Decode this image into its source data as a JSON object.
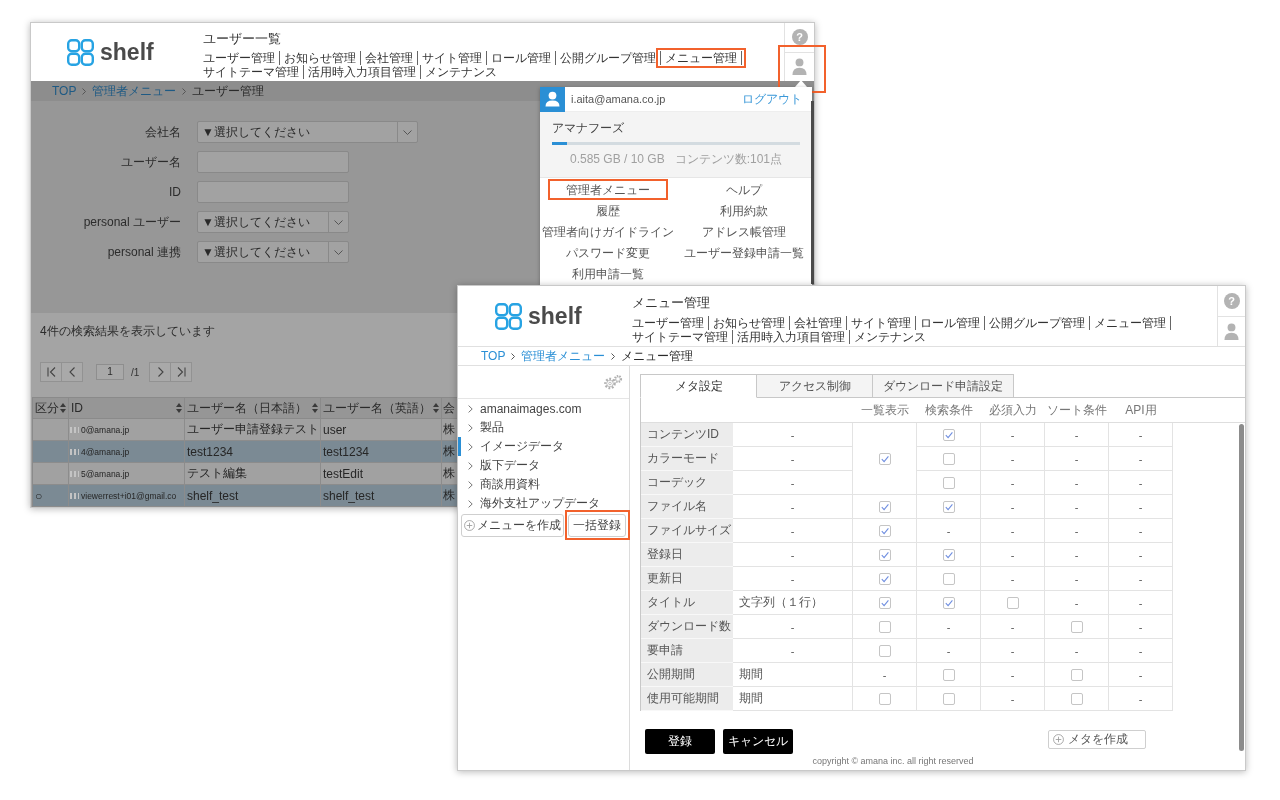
{
  "user_list_window": {
    "logo": "shelf",
    "title": "ユーザー一覧",
    "nav": [
      {
        "label": "ユーザー管理",
        "highlighted": false
      },
      {
        "label": "お知らせ管理",
        "highlighted": false
      },
      {
        "label": "会社管理",
        "highlighted": false
      },
      {
        "label": "サイト管理",
        "highlighted": false
      },
      {
        "label": "ロール管理",
        "highlighted": false
      },
      {
        "label": "公開グループ管理",
        "highlighted": false
      },
      {
        "label": "メニュー管理",
        "highlighted": true
      },
      {
        "label": "サイトテーマ管理",
        "highlighted": false
      },
      {
        "label": "活用時入力項目管理",
        "highlighted": false
      },
      {
        "label": "メンテナンス",
        "highlighted": false
      }
    ],
    "help": "?",
    "user_button": {
      "highlighted": true
    },
    "breadcrumb": [
      {
        "label": "TOP",
        "link": true
      },
      {
        "label": "管理者メニュー",
        "link": true
      },
      {
        "label": "ユーザー管理",
        "link": false
      }
    ],
    "search_form": [
      {
        "label": "会社名",
        "kind": "select",
        "value": "▼選択してください"
      },
      {
        "label": "ユーザー名",
        "kind": "text"
      },
      {
        "label": "ID",
        "kind": "text"
      },
      {
        "label": "personal ユーザー",
        "kind": "select",
        "value": "▼選択してください"
      },
      {
        "label": "personal 連携",
        "kind": "select",
        "value": "▼選択してください"
      }
    ],
    "result_count": "4件の検索結果を表示しています",
    "pager": {
      "page": "1",
      "total": "/1"
    },
    "table": {
      "columns": [
        {
          "label": "区分",
          "sortable": true
        },
        {
          "label": "ID",
          "sortable": true
        },
        {
          "label": "ユーザー名（日本語）",
          "sortable": true
        },
        {
          "label": "ユーザー名（英語）",
          "sortable": true
        },
        {
          "label": "会"
        }
      ],
      "rows": [
        {
          "id_masked": true,
          "id": "0@amana.jp",
          "name_ja": "ユーザー申請登録テスト",
          "name_en": "user",
          "column_5": "株"
        },
        {
          "id_masked": true,
          "id": "4@amana.jp",
          "name_ja": "test1234",
          "name_en": "test1234",
          "column_5": "株"
        },
        {
          "id_masked": true,
          "id": "5@amana.jp",
          "name_ja": "テスト編集",
          "name_en": "testEdit",
          "column_5": "株"
        },
        {
          "category": "○",
          "id_masked": true,
          "id": "viewerrest+i01@gmail.co",
          "name_ja": "shelf_test",
          "name_en": "shelf_test",
          "column_5": "株"
        }
      ]
    },
    "account_menu": {
      "email": "i.aita@amana.co.jp",
      "logout": "ログアウト",
      "company": "アマナフーズ",
      "usage": {
        "level": 0.06
      },
      "storage": "0.585 GB / 10 GB",
      "content_count": "コンテンツ数:101点",
      "links": [
        {
          "label": "管理者メニュー",
          "highlighted": true
        },
        {
          "label": "ヘルプ",
          "highlighted": false
        },
        {
          "label": "履歴",
          "highlighted": false
        },
        {
          "label": "利用約款",
          "highlighted": false
        },
        {
          "label": "管理者向けガイドライン",
          "highlighted": false
        },
        {
          "label": "アドレス帳管理",
          "highlighted": false
        },
        {
          "label": "パスワード変更",
          "highlighted": false
        },
        {
          "label": "ユーザー登録申請一覧",
          "highlighted": false
        },
        {
          "label": "利用申請一覧",
          "highlighted": false
        }
      ]
    }
  },
  "menu_window": {
    "logo": "shelf",
    "title": "メニュー管理",
    "nav": [
      {
        "label": "ユーザー管理"
      },
      {
        "label": "お知らせ管理"
      },
      {
        "label": "会社管理"
      },
      {
        "label": "サイト管理"
      },
      {
        "label": "ロール管理"
      },
      {
        "label": "公開グループ管理"
      },
      {
        "label": "メニュー管理"
      },
      {
        "label": "サイトテーマ管理"
      },
      {
        "label": "活用時入力項目管理"
      },
      {
        "label": "メンテナンス"
      }
    ],
    "help": "?",
    "breadcrumb": [
      {
        "label": "TOP",
        "link": true
      },
      {
        "label": "管理者メニュー",
        "link": true
      },
      {
        "label": "メニュー管理",
        "link": false
      }
    ],
    "sidebar": {
      "items": [
        {
          "label": "amanaimages.com",
          "selected": false
        },
        {
          "label": "製品",
          "selected": false
        },
        {
          "label": "イメージデータ",
          "selected": true
        },
        {
          "label": "版下データ",
          "selected": false
        },
        {
          "label": "商談用資料",
          "selected": false
        },
        {
          "label": "海外支社アップデータ",
          "selected": false
        }
      ],
      "buttons": [
        {
          "label": "メニューを作成",
          "kind": "add",
          "highlighted": false
        },
        {
          "label": "一括登録",
          "kind": "plain",
          "highlighted": true
        }
      ]
    },
    "tabs": [
      {
        "label": "メタ設定",
        "selected": true
      },
      {
        "label": "アクセス制御",
        "selected": false
      },
      {
        "label": "ダウンロード申請設定",
        "selected": false
      }
    ],
    "columns": [
      "一覧表示",
      "検索条件",
      "必須入力",
      "ソート条件",
      "API用"
    ],
    "rows": [
      {
        "label": "コンテンツID",
        "value": {
          "kind": "empty",
          "text": "-"
        },
        "cells": [
          {
            "kind": "check",
            "checked": true
          },
          {
            "kind": "check",
            "checked": true
          },
          {
            "kind": "empty",
            "text": "-"
          },
          {
            "kind": "empty",
            "text": "-"
          },
          {
            "kind": "empty",
            "text": "-"
          }
        ]
      },
      {
        "label": "カラーモード",
        "value": {
          "kind": "empty",
          "text": "-"
        },
        "cells": [
          {
            "kind": "covered"
          },
          {
            "kind": "check",
            "checked": false
          },
          {
            "kind": "empty",
            "text": "-"
          },
          {
            "kind": "empty",
            "text": "-"
          },
          {
            "kind": "empty",
            "text": "-"
          }
        ]
      },
      {
        "label": "コーデック",
        "value": {
          "kind": "empty",
          "text": "-"
        },
        "cells": [
          {
            "kind": "covered"
          },
          {
            "kind": "check",
            "checked": false
          },
          {
            "kind": "empty",
            "text": "-"
          },
          {
            "kind": "empty",
            "text": "-"
          },
          {
            "kind": "empty",
            "text": "-"
          }
        ]
      },
      {
        "label": "ファイル名",
        "value": {
          "kind": "empty",
          "text": "-"
        },
        "cells": [
          {
            "kind": "check",
            "checked": true
          },
          {
            "kind": "check",
            "checked": true
          },
          {
            "kind": "empty",
            "text": "-"
          },
          {
            "kind": "empty",
            "text": "-"
          },
          {
            "kind": "empty",
            "text": "-"
          }
        ]
      },
      {
        "label": "ファイルサイズ",
        "value": {
          "kind": "empty",
          "text": "-"
        },
        "cells": [
          {
            "kind": "check",
            "checked": true
          },
          {
            "kind": "empty",
            "text": "-"
          },
          {
            "kind": "empty",
            "text": "-"
          },
          {
            "kind": "empty",
            "text": "-"
          },
          {
            "kind": "empty",
            "text": "-"
          }
        ]
      },
      {
        "label": "登録日",
        "value": {
          "kind": "empty",
          "text": "-"
        },
        "cells": [
          {
            "kind": "check",
            "checked": true
          },
          {
            "kind": "check",
            "checked": true
          },
          {
            "kind": "empty",
            "text": "-"
          },
          {
            "kind": "empty",
            "text": "-"
          },
          {
            "kind": "empty",
            "text": "-"
          }
        ]
      },
      {
        "label": "更新日",
        "value": {
          "kind": "empty",
          "text": "-"
        },
        "cells": [
          {
            "kind": "check",
            "checked": true
          },
          {
            "kind": "check",
            "checked": false
          },
          {
            "kind": "empty",
            "text": "-"
          },
          {
            "kind": "empty",
            "text": "-"
          },
          {
            "kind": "empty",
            "text": "-"
          }
        ]
      },
      {
        "label": "タイトル",
        "value": {
          "kind": "text",
          "text": "文字列（１行）"
        },
        "cells": [
          {
            "kind": "check",
            "checked": true
          },
          {
            "kind": "check",
            "checked": true
          },
          {
            "kind": "check",
            "checked": false
          },
          {
            "kind": "empty",
            "text": "-"
          },
          {
            "kind": "empty",
            "text": "-"
          }
        ]
      },
      {
        "label": "ダウンロード数",
        "value": {
          "kind": "empty",
          "text": "-"
        },
        "cells": [
          {
            "kind": "check",
            "checked": false
          },
          {
            "kind": "empty",
            "text": "-"
          },
          {
            "kind": "empty",
            "text": "-"
          },
          {
            "kind": "check",
            "checked": false
          },
          {
            "kind": "empty",
            "text": "-"
          }
        ]
      },
      {
        "label": "要申請",
        "value": {
          "kind": "empty",
          "text": "-"
        },
        "cells": [
          {
            "kind": "check",
            "checked": false
          },
          {
            "kind": "empty",
            "text": "-"
          },
          {
            "kind": "empty",
            "text": "-"
          },
          {
            "kind": "empty",
            "text": "-"
          },
          {
            "kind": "empty",
            "text": "-"
          }
        ]
      },
      {
        "label": "公開期間",
        "value": {
          "kind": "text",
          "text": "期間"
        },
        "cells": [
          {
            "kind": "empty",
            "text": "-"
          },
          {
            "kind": "check",
            "checked": false
          },
          {
            "kind": "empty",
            "text": "-"
          },
          {
            "kind": "check",
            "checked": false
          },
          {
            "kind": "empty",
            "text": "-"
          }
        ]
      },
      {
        "label": "使用可能期間",
        "value": {
          "kind": "text",
          "text": "期間"
        },
        "cells": [
          {
            "kind": "check",
            "checked": false
          },
          {
            "kind": "check",
            "checked": false
          },
          {
            "kind": "empty",
            "text": "-"
          },
          {
            "kind": "check",
            "checked": false
          },
          {
            "kind": "empty",
            "text": "-"
          }
        ]
      }
    ],
    "actions": [
      {
        "label": "登録",
        "kind": "primary"
      },
      {
        "label": "キャンセル",
        "kind": "primary"
      },
      {
        "label": "メタを作成",
        "kind": "add"
      }
    ],
    "copyright": "copyright © amana inc. all right reserved"
  }
}
